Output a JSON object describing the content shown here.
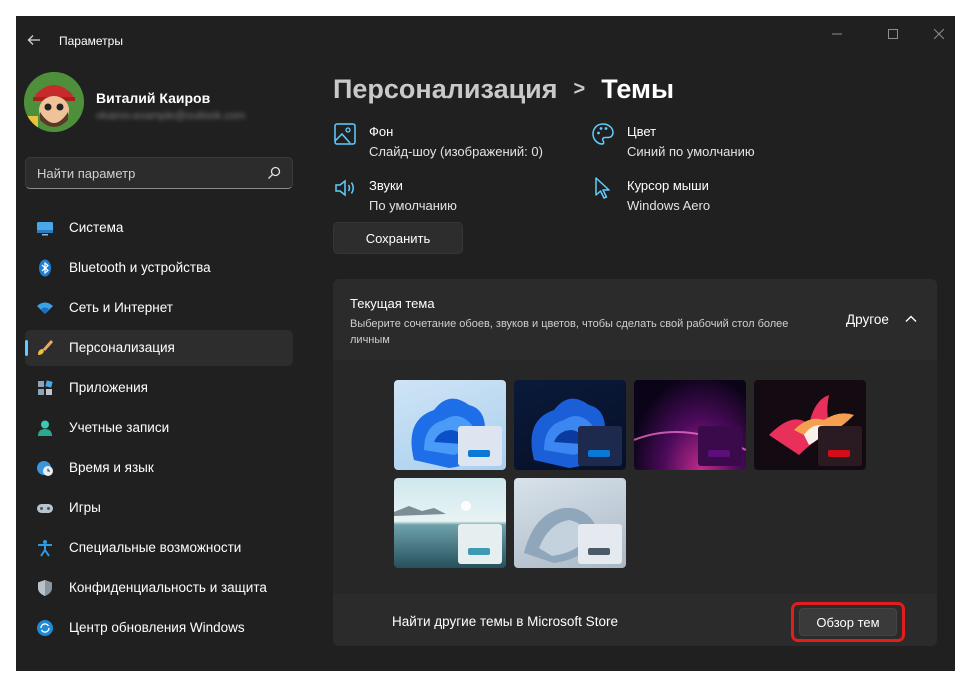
{
  "window": {
    "app_title": "Параметры"
  },
  "user": {
    "name": "Виталий Каиров",
    "email": "vkairov.example@outlook.com"
  },
  "search": {
    "placeholder": "Найти параметр"
  },
  "nav": {
    "items": [
      {
        "label": "Система",
        "icon": "monitor-icon"
      },
      {
        "label": "Bluetooth и устройства",
        "icon": "bluetooth-icon"
      },
      {
        "label": "Сеть и Интернет",
        "icon": "wifi-icon"
      },
      {
        "label": "Персонализация",
        "icon": "brush-icon",
        "active": true
      },
      {
        "label": "Приложения",
        "icon": "apps-icon"
      },
      {
        "label": "Учетные записи",
        "icon": "person-icon"
      },
      {
        "label": "Время и язык",
        "icon": "globe-clock-icon"
      },
      {
        "label": "Игры",
        "icon": "gamepad-icon"
      },
      {
        "label": "Специальные возможности",
        "icon": "accessibility-icon"
      },
      {
        "label": "Конфиденциальность и защита",
        "icon": "shield-icon"
      },
      {
        "label": "Центр обновления Windows",
        "icon": "update-icon"
      }
    ]
  },
  "breadcrumb": {
    "parent": "Персонализация",
    "separator": ">",
    "current": "Темы"
  },
  "props": {
    "background": {
      "title": "Фон",
      "value": "Слайд-шоу (изображений: 0)"
    },
    "color": {
      "title": "Цвет",
      "value": "Синий по умолчанию"
    },
    "sounds": {
      "title": "Звуки",
      "value": "По умолчанию"
    },
    "cursor": {
      "title": "Курсор мыши",
      "value": "Windows Aero"
    }
  },
  "save_button": "Сохранить",
  "current_theme": {
    "title": "Текущая тема",
    "description": "Выберите сочетание обоев, звуков и цветов, чтобы сделать свой рабочий стол более личным",
    "value": "Другое",
    "themes": [
      {
        "name": "windows-light-theme",
        "accent": "#0a78d4"
      },
      {
        "name": "windows-dark-theme",
        "accent": "#0a78d4"
      },
      {
        "name": "glow-theme",
        "accent": "#5a0f7a"
      },
      {
        "name": "captured-motion-theme",
        "accent": "#d40d1a"
      },
      {
        "name": "sunrise-theme",
        "accent": "#3d9ab0"
      },
      {
        "name": "flow-theme",
        "accent": "#4b5a66"
      }
    ]
  },
  "store": {
    "label": "Найти другие темы в Microsoft Store",
    "button": "Обзор тем"
  },
  "colors": {
    "accent": "#60cdff",
    "highlight": "#e11d1d",
    "window_bg": "#202020",
    "card_bg": "#2b2b2b"
  }
}
